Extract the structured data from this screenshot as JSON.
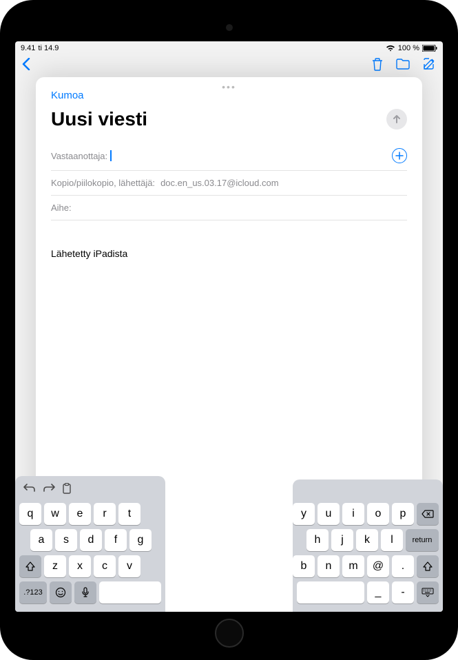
{
  "status_bar": {
    "time": "9.41",
    "date": "ti 14.9",
    "battery_percent": "100 %"
  },
  "compose": {
    "cancel_label": "Kumoa",
    "title": "Uusi viesti",
    "to_label": "Vastaanottaja:",
    "to_value": "",
    "cc_bcc_label": "Kopio/piilokopio, lähettäjä:",
    "cc_bcc_value": "doc.en_us.03.17@icloud.com",
    "subject_label": "Aihe:",
    "subject_value": "",
    "body_signature": "Lähetetty iPadista"
  },
  "keyboard": {
    "left": {
      "row1": [
        "q",
        "w",
        "e",
        "r",
        "t"
      ],
      "row2": [
        "a",
        "s",
        "d",
        "f",
        "g"
      ],
      "row3": [
        "z",
        "x",
        "c",
        "v"
      ],
      "num_label": ".?123"
    },
    "right": {
      "row1": [
        "y",
        "u",
        "i",
        "o",
        "p"
      ],
      "row2": [
        "h",
        "j",
        "k",
        "l"
      ],
      "row3": [
        "b",
        "n",
        "m",
        "@",
        "."
      ],
      "return_label": "return",
      "underscore": "_",
      "dash": "-"
    }
  }
}
